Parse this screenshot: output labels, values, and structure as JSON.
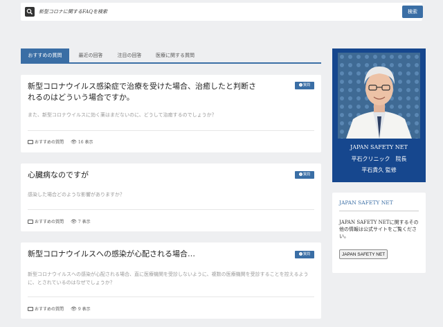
{
  "search": {
    "placeholder": "新型コロナに関するFAQを検索",
    "button_label": "検索"
  },
  "tabs": [
    {
      "label": "おすすめの質問",
      "active": true
    },
    {
      "label": "最近の回答",
      "active": false
    },
    {
      "label": "注目の回答",
      "active": false
    },
    {
      "label": "医療に関する質問",
      "active": false
    }
  ],
  "cards": [
    {
      "title": "新型コロナウイルス感染症で治療を受けた場合、治癒したと判断されるのはどういう場合ですか。",
      "badge": "質問",
      "excerpt": "また、新型コロナウイルスに効く薬はまだないのに、どうして治癒するのでしょうか？",
      "category": "おすすめの質問",
      "views": "16 表示"
    },
    {
      "title": "心臓病なのですが",
      "badge": "質問",
      "excerpt": "感染した場合どのような影響がありますか？",
      "category": "おすすめの質問",
      "views": "7 表示"
    },
    {
      "title": "新型コロナウイルスへの感染が心配される場合…",
      "badge": "質問",
      "excerpt": "新型コロナウイルスへの感染が心配される場合、直に医療機関を受診しないように、複数の医療機関を受診することを控えるように、とされているのはなぜでしょうか？",
      "category": "おすすめの質問",
      "views": "9 表示"
    }
  ],
  "sidebar": {
    "banner": {
      "line1": "JAPAN SAFETY NET",
      "line2": "平石クリニック　院長",
      "line3": "平石貴久 監修"
    },
    "widget": {
      "title": "JAPAN SAFETY NET",
      "text": "JAPAN SAFETY NETに関するその他の情報は公式サイトをご覧ください。",
      "button_label": "JAPAN SAFETY NET"
    }
  },
  "colors": {
    "accent": "#3a6ea5",
    "banner": "#16478e",
    "background": "#eeeff1"
  }
}
